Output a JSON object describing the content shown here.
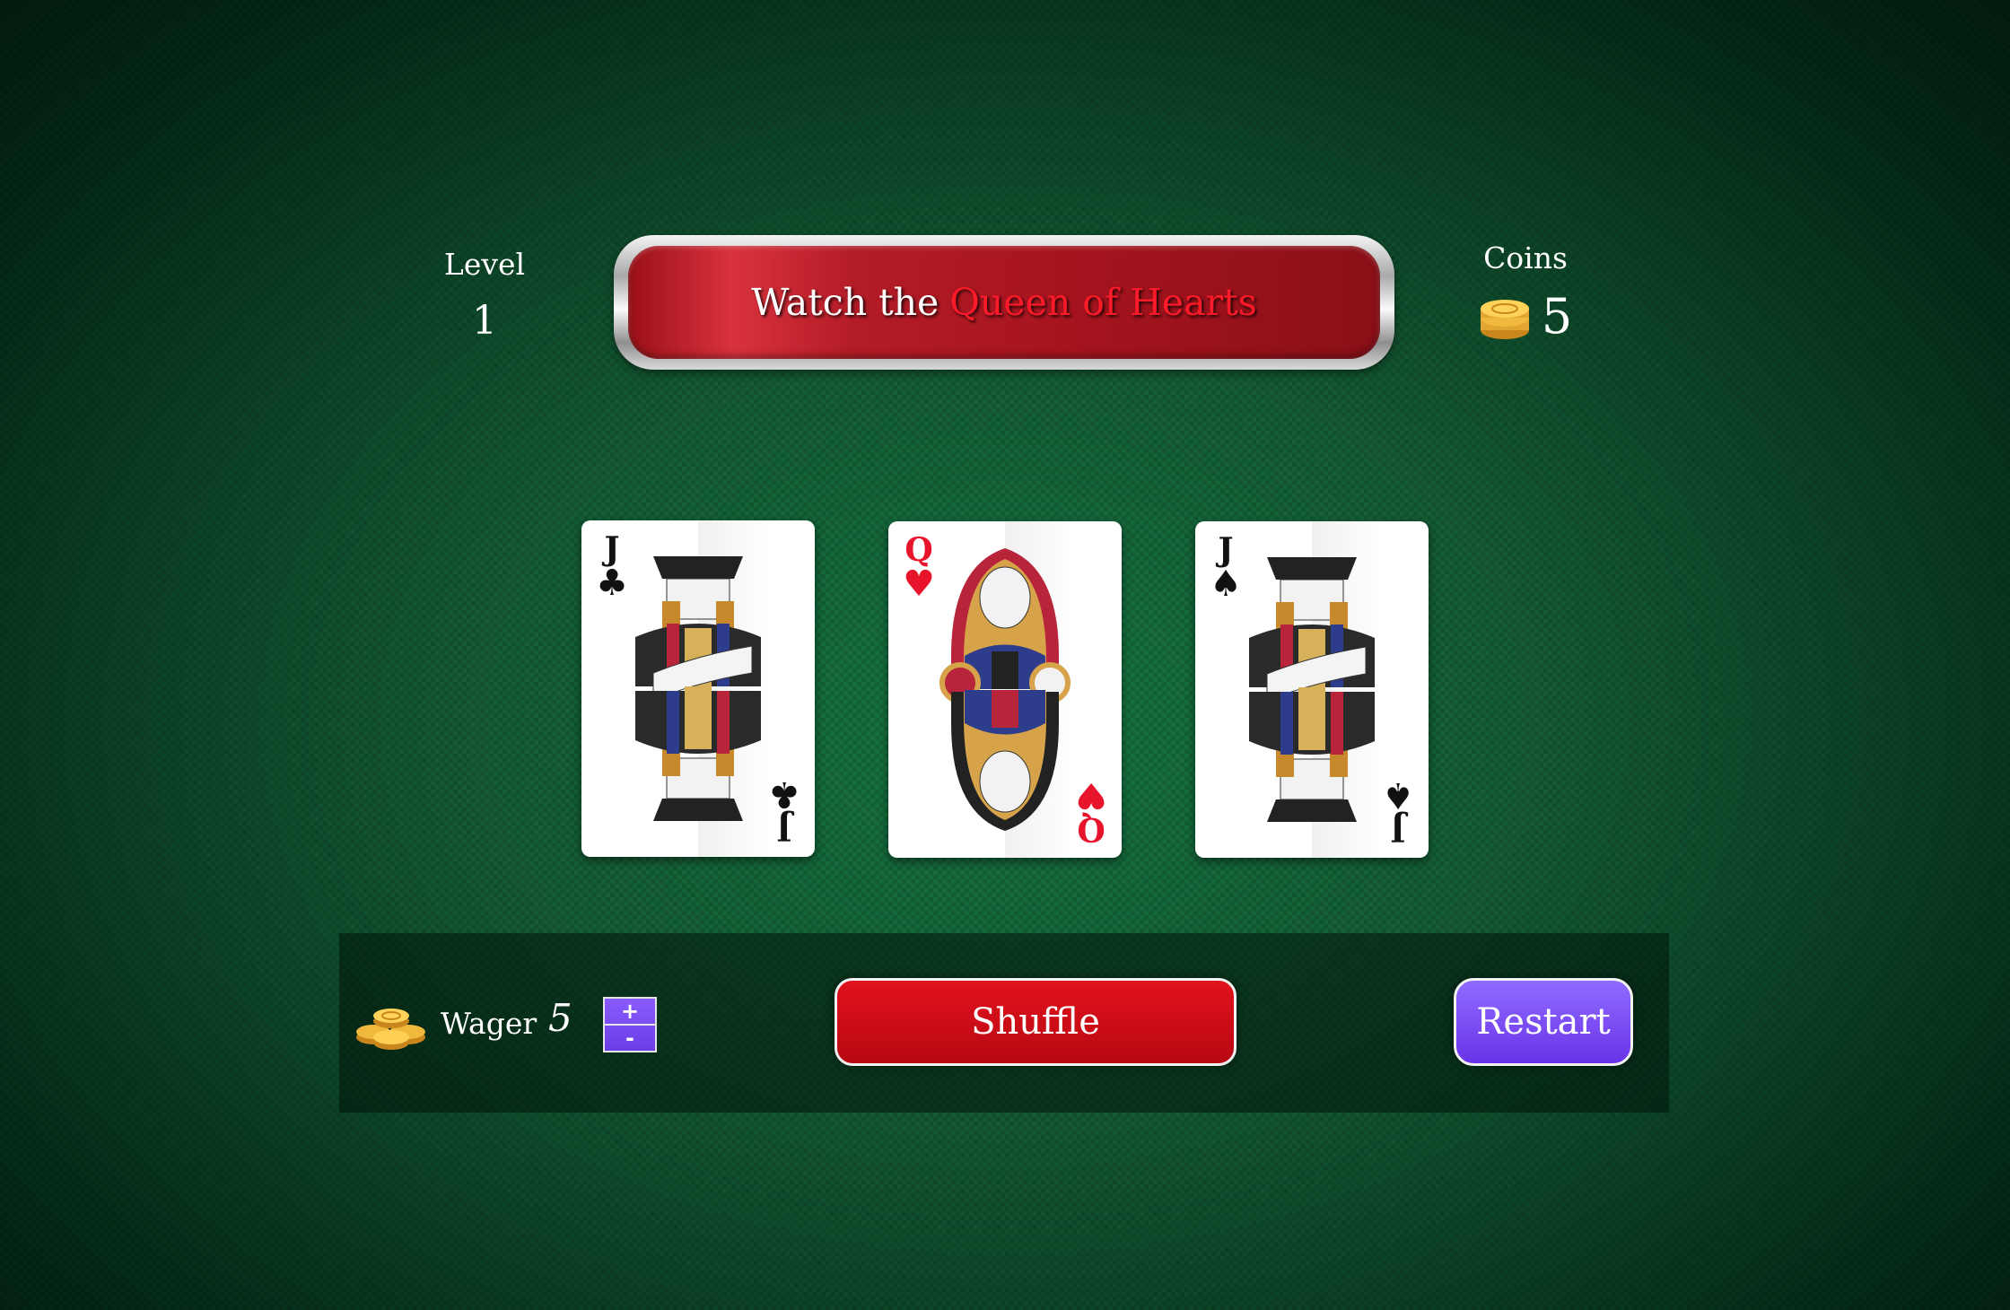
{
  "level": {
    "label": "Level",
    "value": "1"
  },
  "coins": {
    "label": "Coins",
    "value": "5",
    "icon": "coin-stack-icon"
  },
  "banner": {
    "prefix": "Watch the",
    "highlight": "Queen of Hearts"
  },
  "cards": [
    {
      "rank": "J",
      "suit": "♣",
      "color": "black",
      "name": "Jack of Clubs"
    },
    {
      "rank": "Q",
      "suit": "♥",
      "color": "red",
      "name": "Queen of Hearts"
    },
    {
      "rank": "J",
      "suit": "♠",
      "color": "black",
      "name": "Jack of Spades"
    }
  ],
  "wager": {
    "label": "Wager",
    "value": "5",
    "plus": "+",
    "minus": "-",
    "icon": "coin-pile-icon"
  },
  "buttons": {
    "shuffle": "Shuffle",
    "restart": "Restart"
  },
  "colors": {
    "table": "#07602f",
    "shuffle": "#d00c16",
    "restart": "#7a4af2",
    "highlight": "#ff1a2a"
  }
}
